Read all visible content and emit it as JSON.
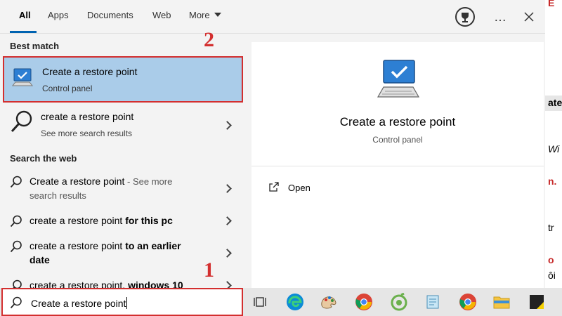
{
  "tabs": [
    {
      "label": "All",
      "active": true
    },
    {
      "label": "Apps"
    },
    {
      "label": "Documents"
    },
    {
      "label": "Web"
    },
    {
      "label": "More"
    }
  ],
  "more_icon": "…",
  "best_match": {
    "heading": "Best match",
    "title": "Create a restore point",
    "subtitle": "Control panel",
    "icon": "monitor-check-icon"
  },
  "search_result": {
    "title": "create a restore point",
    "subtitle": "See more search results"
  },
  "search_web": {
    "heading": "Search the web",
    "items": [
      {
        "text": "Create a restore point",
        "bold": "",
        "suffix": " - See more",
        "line2": "search results"
      },
      {
        "text": "create a restore point ",
        "bold": "for this pc",
        "suffix": "",
        "line2": ""
      },
      {
        "text": "create a restore point ",
        "bold": "to an earlier",
        "suffix": "",
        "line2": "date"
      },
      {
        "text": "create a restore point, ",
        "bold": "windows 10",
        "suffix": "",
        "line2": ""
      }
    ]
  },
  "preview": {
    "title": "Create a restore point",
    "subtitle": "Control panel",
    "actions": [
      {
        "label": "Open",
        "icon": "open-icon"
      }
    ]
  },
  "search_box": {
    "value": "Create a restore point"
  },
  "annotations": {
    "step_search": "1",
    "step_result": "2"
  },
  "background_page": {
    "fragments": [
      "E",
      "ate",
      "Wi",
      "n.",
      "tr",
      "o",
      "ôi"
    ]
  },
  "colors": {
    "highlight": "#aacce9",
    "accent": "#0063b1",
    "annotation_red": "#d32f2f"
  },
  "taskbar_icons": [
    "task-view-icon",
    "edge-icon",
    "paint-icon",
    "chrome-icon",
    "app-icon",
    "notepad-icon",
    "chrome-icon",
    "file-explorer-icon",
    "sticky-notes-icon"
  ]
}
